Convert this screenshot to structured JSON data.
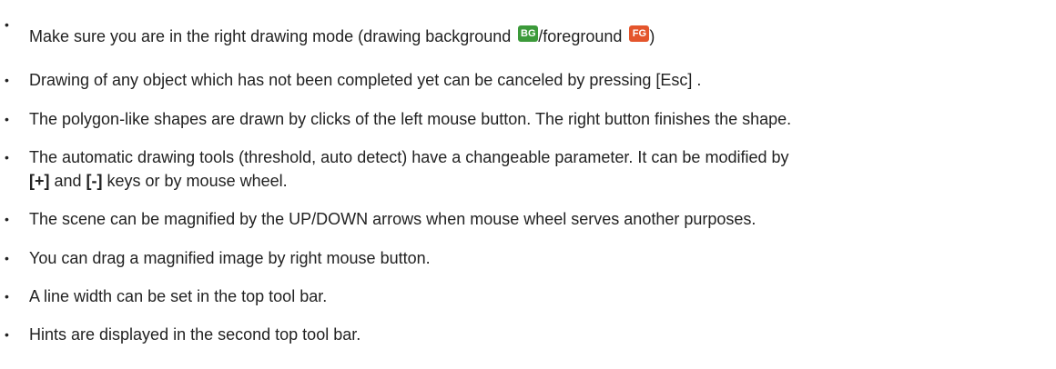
{
  "items": [
    {
      "pre": "Make sure you are in the right drawing mode (drawing background ",
      "mid": "/foreground ",
      "post": ")"
    },
    {
      "text": "Drawing of any object which has not been completed yet can be canceled by pressing [Esc] ."
    },
    {
      "text": "The polygon-like shapes are drawn by clicks of the left mouse button. The right button finishes the shape."
    },
    {
      "line1": "The automatic drawing tools (threshold, auto detect) have a changeable parameter. It can be modified by",
      "plus_key": "[+]",
      "and": " and ",
      "minus_key": "[-]",
      "tail": " keys or by mouse wheel."
    },
    {
      "text": "The scene can be magnified by the UP/DOWN arrows when mouse wheel serves another purposes."
    },
    {
      "text": "You can drag a magnified image by right mouse button."
    },
    {
      "text": "A line width can be set in the top tool bar."
    },
    {
      "text": "Hints are displayed in the second top tool bar."
    }
  ],
  "badges": {
    "bg": "BG",
    "fg": "FG",
    "bg_color": "#3c9a3a",
    "fg_color": "#e4552c"
  },
  "bullet": "•",
  "text_color": "#222222"
}
